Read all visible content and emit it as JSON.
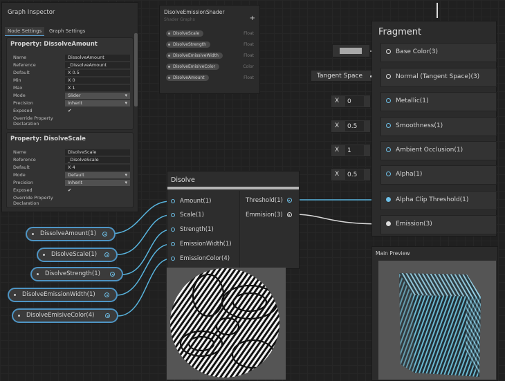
{
  "inspector": {
    "title": "Graph Inspector",
    "tabs": [
      "Node Settings",
      "Graph Settings"
    ],
    "properties": [
      {
        "header": "Property: DissolveAmount",
        "rows": [
          {
            "label": "Name",
            "value": "DissolveAmount"
          },
          {
            "label": "Reference",
            "value": "_DissolveAmount"
          },
          {
            "label": "Default",
            "value": "X  0.5"
          },
          {
            "label": "Min",
            "value": "X  0"
          },
          {
            "label": "Max",
            "value": "X  1"
          },
          {
            "label": "Mode",
            "value": "Slider"
          },
          {
            "label": "Precision",
            "value": "Inherit"
          },
          {
            "label": "Exposed",
            "value": "✔"
          },
          {
            "label": "Override Property",
            "value": ""
          },
          {
            "label": "Declaration",
            "value": ""
          }
        ]
      },
      {
        "header": "Property: DisolveScale",
        "rows": [
          {
            "label": "Name",
            "value": "DisolveScale"
          },
          {
            "label": "Reference",
            "value": "_DisolveScale"
          },
          {
            "label": "Default",
            "value": "X  4"
          },
          {
            "label": "Mode",
            "value": "Default"
          },
          {
            "label": "Precision",
            "value": "Inherit"
          },
          {
            "label": "Exposed",
            "value": "✔"
          },
          {
            "label": "Override Property",
            "value": ""
          },
          {
            "label": "Declaration",
            "value": ""
          }
        ]
      }
    ]
  },
  "blackboard": {
    "title": "DisolveEmissionShader",
    "subtitle": "Shader Graphs",
    "add": "+",
    "items": [
      {
        "name": "DisolveScale",
        "type": "Float"
      },
      {
        "name": "DisolveStrength",
        "type": "Float"
      },
      {
        "name": "DisolveEmissiveWidth",
        "type": "Float"
      },
      {
        "name": "DisolveEmisiveColor",
        "type": "Color"
      },
      {
        "name": "DisolveAmount",
        "type": "Float"
      }
    ]
  },
  "fragment": {
    "title": "Fragment",
    "slots": [
      "Base Color(3)",
      "Normal (Tangent Space)(3)",
      "Metallic(1)",
      "Smoothness(1)",
      "Ambient Occlusion(1)",
      "Alpha(1)",
      "Alpha Clip Threshold(1)",
      "Emission(3)"
    ],
    "normal_space": "Tangent Space",
    "metallic": {
      "axis": "X",
      "value": "0"
    },
    "smoothness": {
      "axis": "X",
      "value": "0.5"
    },
    "occlusion": {
      "axis": "X",
      "value": "1"
    },
    "alpha": {
      "axis": "X",
      "value": "0.5"
    },
    "base_color_swatch": "#a9a9a9"
  },
  "disolve_node": {
    "title": "Disolve",
    "inputs": [
      "Amount(1)",
      "Scale(1)",
      "Strength(1)",
      "EmissionWidth(1)",
      "EmissionColor(4)"
    ],
    "outputs": [
      "Threshold(1)",
      "Emmision(3)"
    ]
  },
  "property_nodes": [
    "DissolveAmount(1)",
    "DisolveScale(1)",
    "DisolveStrength(1)",
    "DisolveEmissionWidth(1)",
    "DisolveEmisiveColor(4)"
  ],
  "main_preview": {
    "title": "Main Preview"
  },
  "colors": {
    "accent": "#4e95c5",
    "wire": "#58b4de"
  }
}
